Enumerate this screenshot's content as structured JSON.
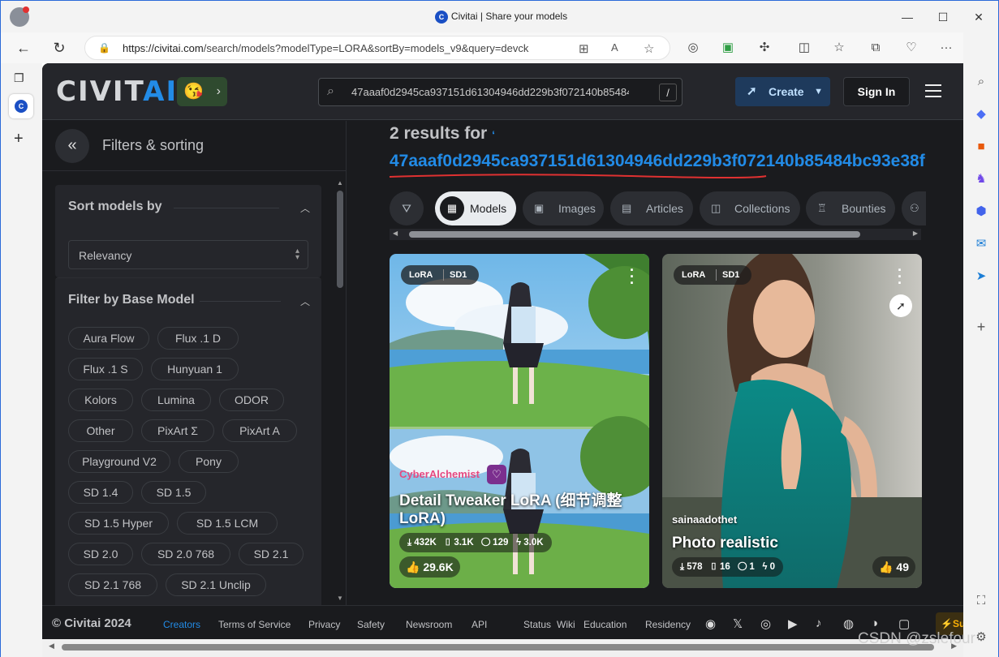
{
  "window": {
    "title": "Civitai | Share your models",
    "tab_icon": "C"
  },
  "browser": {
    "url_host": "https://civitai.com",
    "url_path": "/search/models?modelType=LORA&sortBy=models_v9&query=devck"
  },
  "site": {
    "logo_main": "CIVIT",
    "logo_accent": "AI",
    "emoji": "😘",
    "search_query": "47aaaf0d2945ca937151d61304946dd229b3f072140b85484bc93e38f",
    "search_shortcut": "/",
    "create_label": "Create",
    "signin_label": "Sign In"
  },
  "filters": {
    "title": "Filters & sorting",
    "sort_title": "Sort models by",
    "sort_value": "Relevancy",
    "base_title": "Filter by Base Model",
    "base_models": [
      "Aura Flow",
      "Flux .1 D",
      "Flux .1 S",
      "Hunyuan 1",
      "Kolors",
      "Lumina",
      "ODOR",
      "Other",
      "PixArt Σ",
      "PixArt A",
      "Playground V2",
      "Pony",
      "SD 1.4",
      "SD 1.5",
      "SD 1.5 Hyper",
      "SD 1.5 LCM",
      "SD 2.0",
      "SD 2.0 768",
      "SD 2.1",
      "SD 2.1 768",
      "SD 2.1 Unclip"
    ]
  },
  "results": {
    "count_text": "2 results for",
    "quote_mark": "‘",
    "query": "47aaaf0d2945ca937151d61304946dd229b3f072140b85484bc93e38f",
    "tabs": [
      "Models",
      "Images",
      "Articles",
      "Collections",
      "Bounties"
    ]
  },
  "cards": [
    {
      "type": "LoRA",
      "base": "SD1",
      "creator": "CyberAlchemist",
      "title": "Detail Tweaker LoRA (细节调整LoRA)",
      "downloads": "432K",
      "saves": "3.1K",
      "comments": "129",
      "buzz": "3.0K",
      "likes": "29.6K"
    },
    {
      "type": "LoRA",
      "base": "SD1",
      "creator": "sainaadothet",
      "title": "Photo realistic",
      "downloads": "578",
      "saves": "16",
      "comments": "1",
      "buzz": "0",
      "likes": "49"
    }
  ],
  "footer": {
    "copyright": "© Civitai 2024",
    "links": [
      "Creators",
      "Terms of Service",
      "Privacy",
      "Safety",
      "Newsroom",
      "API",
      "Status",
      "Wiki",
      "Education",
      "Residency"
    ],
    "support": "Sup"
  },
  "watermark": "CSDN @zslefour",
  "colors": {
    "accent": "#228be6",
    "bg": "#1a1b1e",
    "panel": "#25262b",
    "creator_pink": "#e64980"
  }
}
